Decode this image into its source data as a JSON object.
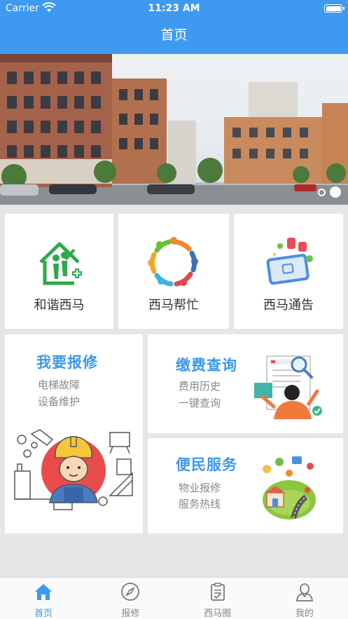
{
  "status_bar": {
    "carrier": "Carrier",
    "time": "11:23 AM"
  },
  "nav": {
    "title": "首页"
  },
  "tiles": [
    {
      "label": "和谐西马"
    },
    {
      "label": "西马帮忙"
    },
    {
      "label": "西马通告"
    }
  ],
  "repair": {
    "title": "我要报修",
    "line1": "电梯故障",
    "line2": "设备维护"
  },
  "payment": {
    "title": "缴费查询",
    "line1": "费用历史",
    "line2": "一键查询"
  },
  "service": {
    "title": "便民服务",
    "line1": "物业报修",
    "line2": "服务热线"
  },
  "tabbar": {
    "items": [
      {
        "label": "首页",
        "icon": "home-icon",
        "active": true
      },
      {
        "label": "报修",
        "icon": "compass-icon",
        "active": false
      },
      {
        "label": "西马圈",
        "icon": "clipboard-icon",
        "active": false
      },
      {
        "label": "我的",
        "icon": "person-icon",
        "active": false
      }
    ]
  },
  "colors": {
    "brand_blue": "#3d9af0",
    "title_blue": "#3b98ea",
    "home_green": "#2ea84a"
  }
}
